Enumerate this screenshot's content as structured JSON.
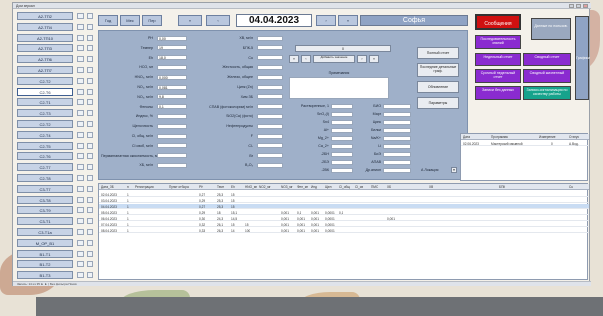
{
  "window": {
    "title": "Дом зеркал"
  },
  "sidebar": {
    "items": [
      {
        "label": "А2-ТП2"
      },
      {
        "label": "А2-ТП4"
      },
      {
        "label": "А2-ТП10"
      },
      {
        "label": "А2-ТП3"
      },
      {
        "label": "А2-ТП6"
      },
      {
        "label": "А2-ТП7"
      },
      {
        "label": "С2-Т2"
      },
      {
        "label": "С2-Т6"
      },
      {
        "label": "С2-Т1"
      },
      {
        "label": "С2-Т3"
      },
      {
        "label": "С2-Т2"
      },
      {
        "label": "С2-Т4"
      },
      {
        "label": "С2-Т5"
      },
      {
        "label": "С2-Т6"
      },
      {
        "label": "С2-Т7"
      },
      {
        "label": "С2-Т8"
      },
      {
        "label": "С3-Т7"
      },
      {
        "label": "С3-Т8"
      },
      {
        "label": "С3-Т9"
      },
      {
        "label": "С3-Т1"
      },
      {
        "label": "С3-Т1а"
      },
      {
        "label": "М_ОР_В1"
      },
      {
        "label": "В1-Т1"
      },
      {
        "label": "В1-Т2"
      },
      {
        "label": "В1-Т3"
      }
    ]
  },
  "topnav": {
    "buttons": [
      "Год",
      "Мес",
      "Пер",
      "«",
      "‹"
    ],
    "date": "04.04.2023",
    "next_buttons": [
      "›",
      "»"
    ],
    "name": "Софья"
  },
  "form_left": [
    {
      "label": "PH",
      "value": "0,00"
    },
    {
      "label": "Темпер",
      "value": "19"
    },
    {
      "label": "Eh",
      "value": "18,0"
    },
    {
      "label": "HCO, мг",
      "value": ""
    },
    {
      "label": "HNO₃, мг/л",
      "value": "0,000"
    },
    {
      "label": "NO₂, мг/л",
      "value": "0,081"
    },
    {
      "label": "NO₃, мг/л",
      "value": "9,8"
    },
    {
      "label": "Фенолы",
      "value": "0,1"
    },
    {
      "label": "Индекс, %",
      "value": ""
    },
    {
      "label": "Щелочность",
      "value": ""
    },
    {
      "label": "Cl, общ, мг/л",
      "value": ""
    },
    {
      "label": "Cl своб, мг/л",
      "value": ""
    },
    {
      "label": "Перманганатная окисляемость, мгО2/л",
      "value": ""
    },
    {
      "label": "ХБ, мг/л",
      "value": ""
    }
  ],
  "form_mid": [
    {
      "label": "ХВ, мг/л",
      "value": ""
    },
    {
      "label": "БПК-5",
      "value": ""
    },
    {
      "label": "Cu",
      "value": ""
    },
    {
      "label": "Жесткость, общая",
      "value": ""
    },
    {
      "label": "Железо, общее",
      "value": ""
    },
    {
      "label": "Цинк (Zn)",
      "value": ""
    },
    {
      "label": "Хим ЗБ",
      "value": ""
    },
    {
      "label": "СПАВ (фотоколорим) мг/л",
      "value": ""
    },
    {
      "label": "SiO2(Ca) (фото)",
      "value": ""
    },
    {
      "label": "Нефтепродукты",
      "value": ""
    },
    {
      "label": "F",
      "value": ""
    },
    {
      "label": "Cl-",
      "value": ""
    },
    {
      "label": "Br",
      "value": ""
    },
    {
      "label": "B₂O₃",
      "value": ""
    }
  ],
  "center": {
    "counter_value": "0",
    "counter_caption": "Добавить значение",
    "notes_label": "Примечания",
    "dissolved_label": "Растворенные, 1"
  },
  "form_right": [
    {
      "label": "Растворенные, 1",
      "value": ""
    },
    {
      "label": "SnO₂(I)",
      "value": ""
    },
    {
      "label": "Sn4",
      "value": ""
    },
    {
      "label": "Al+",
      "value": ""
    },
    {
      "label": "Mg_2+",
      "value": ""
    },
    {
      "label": "Ca_2+",
      "value": ""
    },
    {
      "label": "-2БН",
      "value": ""
    },
    {
      "label": "-2БЭ",
      "value": ""
    },
    {
      "label": "-2ВК",
      "value": ""
    }
  ],
  "form_far": [
    {
      "label": "БИО"
    },
    {
      "label": "Марг"
    },
    {
      "label": "Цинк"
    },
    {
      "label": "Белки"
    },
    {
      "label": "Na/K+"
    },
    {
      "label": "Li"
    },
    {
      "label": "БиЭ"
    },
    {
      "label": "АПАВ"
    },
    {
      "label": "Др.анион"
    }
  ],
  "side_buttons": [
    "Полный отчет",
    "Последние детальные граф.",
    "Обновление",
    "Параметры"
  ],
  "selector_label": "А Локация",
  "right_panel": {
    "messages": "Сообщения",
    "info": "Данные по пользов.",
    "buttons": [
      {
        "label": "Последовательность знаний",
        "color": "#8a2bd0"
      },
      {
        "label": "Недельный отчет",
        "color": "#8a2bd0"
      },
      {
        "label": "Сводный отчет",
        "color": "#8a2bd0"
      },
      {
        "label": "Срочный недельный отчет",
        "color": "#8a2bd0"
      },
      {
        "label": "Сводный жизненный",
        "color": "#8a2bd0"
      },
      {
        "label": "Записи без данных",
        "color": "#8a2bd0"
      },
      {
        "label": "Записи-сигнализация по качеству работы",
        "color": "#16a38c"
      }
    ],
    "graph_label": "Графики"
  },
  "mini_table": {
    "headers": [
      "Дата",
      "Программа",
      "Измерение",
      "Статус"
    ],
    "row": [
      "02.06.2023",
      "Мастерский смывной",
      "0",
      "А.Вод."
    ]
  },
  "grid": {
    "headers": [
      "Дата_ЗБ",
      "п",
      "Регистрация",
      "Пункт отбора",
      "PH",
      "Темп",
      "Eh",
      "HNO_мг",
      "NO2_мг",
      "NO3_мг",
      "Фен_мг",
      "Инд",
      "Щел",
      "Cl_общ",
      "Cl_св",
      "ПМО",
      "ХБ",
      "ХВ",
      "БПК",
      "Cu"
    ],
    "rows": [
      [
        "02.04.2023",
        "1",
        "",
        "",
        "0,27",
        "25,3",
        "15",
        "",
        "",
        "",
        "",
        "",
        "",
        "",
        "",
        "",
        "",
        "",
        "",
        ""
      ],
      [
        "03.04.2023",
        "1",
        "",
        "",
        "0,29",
        "25,3",
        "15",
        "",
        "",
        "",
        "",
        "",
        "",
        "",
        "",
        "",
        "",
        "",
        "",
        ""
      ],
      [
        "04.04.2023",
        "1",
        "",
        "",
        "0,27",
        "25,3",
        "15",
        "",
        "",
        "",
        "",
        "",
        "",
        "",
        "",
        "",
        "",
        "",
        "",
        ""
      ],
      [
        "05.04.2023",
        "1",
        "",
        "",
        "0,29",
        "18",
        "15,1",
        "",
        "",
        "0,001",
        "0,1",
        "0,001",
        "0,0001",
        "0,1",
        "",
        "",
        "",
        "",
        "",
        ""
      ],
      [
        "06.04.2023",
        "1",
        "",
        "",
        "0,30",
        "24,3",
        "14,5",
        "",
        "",
        "0,001",
        "0,001",
        "0,001",
        "0,0001",
        "",
        "",
        "",
        "0,001",
        "",
        "",
        ""
      ],
      [
        "07.04.2023",
        "1",
        "",
        "",
        "0,32",
        "26,1",
        "15",
        "15",
        "",
        "0,001",
        "0,001",
        "0,001",
        "0,0001",
        "",
        "",
        "",
        "",
        "",
        "",
        ""
      ],
      [
        "08.04.2023",
        "1",
        "",
        "",
        "0,33",
        "26,3",
        "14",
        "100",
        "",
        "0,001",
        "0,001",
        "0,001",
        "0,0001",
        "",
        "",
        "",
        "",
        "",
        "",
        ""
      ]
    ]
  },
  "status": {
    "text": "Запись: 14 из 35 ►  ► |  Без фильтра  Поиск"
  }
}
